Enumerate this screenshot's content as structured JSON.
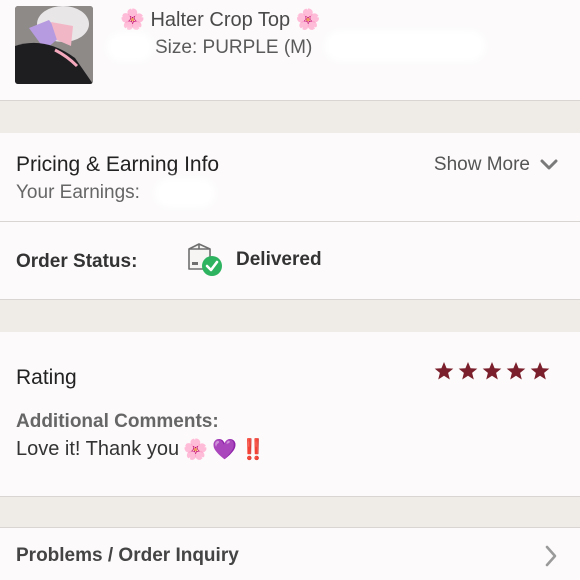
{
  "product": {
    "emoji_left": "🌸",
    "title": "Halter Crop Top",
    "emoji_right": "🌸",
    "size_text": "Size: PURPLE (M)",
    "thumbnail_icon": "product-thumbnail"
  },
  "pricing": {
    "title": "Pricing & Earning Info",
    "earnings_label": "Your Earnings:",
    "show_more_label": "Show More",
    "show_more_icon": "chevron-down-icon"
  },
  "status": {
    "label": "Order Status:",
    "value": "Delivered",
    "icon": "delivered-box-icon",
    "check_color": "#2eb360"
  },
  "rating": {
    "label": "Rating",
    "stars": 5,
    "star_color": "#7a1f2b",
    "comments_label": "Additional Comments:",
    "comments_text": "Love it! Thank you",
    "comments_emoji": [
      "🌸",
      "💜",
      "‼️"
    ]
  },
  "problems": {
    "label": "Problems / Order Inquiry",
    "icon": "chevron-right-icon"
  },
  "colors": {
    "background": "#fcfafa",
    "section_gap": "#efece8",
    "divider": "#d9d5d2"
  }
}
